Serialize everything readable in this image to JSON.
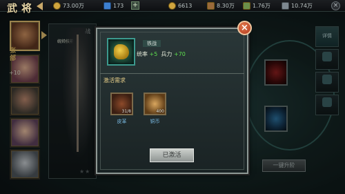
{
  "header": {
    "title": "武将",
    "resources": [
      {
        "icon": "gold-coin-icon",
        "value": "73.00万"
      },
      {
        "icon": "ingot-icon",
        "value": "173"
      },
      {
        "icon": "grain-icon",
        "value": "6613"
      },
      {
        "icon": "wood-icon",
        "value": "8.30万"
      },
      {
        "icon": "stone-icon",
        "value": "1.76万"
      },
      {
        "icon": "iron-icon",
        "value": "10.74万"
      }
    ]
  },
  "character": {
    "name": "统帅技能",
    "side_label": "张郃",
    "bonus": "+10",
    "partial_label": "战"
  },
  "tabs": [
    "详情"
  ],
  "right_button": "一键升阶",
  "modal": {
    "item_name": "铁战",
    "stats_prefix": "统率",
    "stat1_value": "+5",
    "stats_mid": "兵力",
    "stat2_value": "+70",
    "requirements_label": "激活需求",
    "materials": [
      {
        "name": "皮革",
        "count": "31/8",
        "icon": "leather-icon"
      },
      {
        "name": "铜币",
        "count": "400",
        "icon": "copper-coin-icon"
      }
    ],
    "button_label": "已激活",
    "close_glyph": "×"
  }
}
